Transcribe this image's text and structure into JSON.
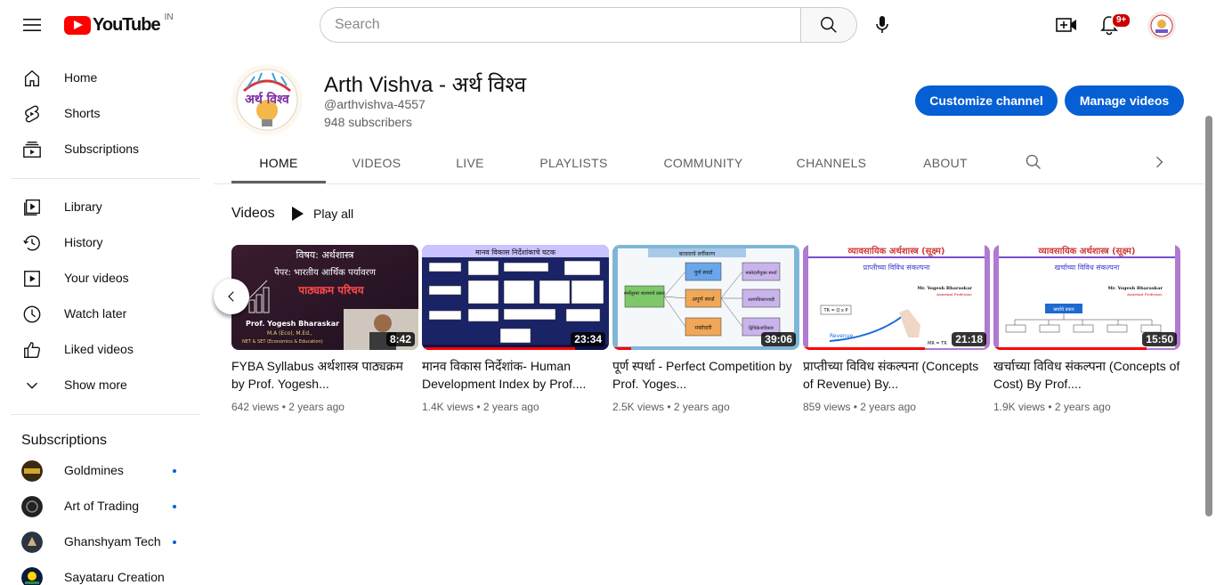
{
  "masthead": {
    "logo_text": "YouTube",
    "country_code": "IN",
    "search_placeholder": "Search",
    "notification_count": "9+"
  },
  "sidebar": {
    "primary": [
      {
        "label": "Home",
        "icon": "home-icon"
      },
      {
        "label": "Shorts",
        "icon": "shorts-icon"
      },
      {
        "label": "Subscriptions",
        "icon": "subscriptions-icon"
      }
    ],
    "library": [
      {
        "label": "Library",
        "icon": "library-icon"
      },
      {
        "label": "History",
        "icon": "history-icon"
      },
      {
        "label": "Your videos",
        "icon": "your-videos-icon"
      },
      {
        "label": "Watch later",
        "icon": "watch-later-icon"
      },
      {
        "label": "Liked videos",
        "icon": "liked-videos-icon"
      },
      {
        "label": "Show more",
        "icon": "chevron-down-icon"
      }
    ],
    "subscriptions_heading": "Subscriptions",
    "subscriptions": [
      {
        "label": "Goldmines",
        "new": true
      },
      {
        "label": "Art of Trading",
        "new": true
      },
      {
        "label": "Ghanshyam Tech",
        "new": true
      },
      {
        "label": "Sayataru Creation",
        "new": false
      }
    ]
  },
  "channel": {
    "name": "Arth Vishva - अर्थ विश्व",
    "handle": "@arthvishva-4557",
    "subscribers": "948 subscribers",
    "customize_label": "Customize channel",
    "manage_label": "Manage videos",
    "avatar_text": "अर्थ विश्व"
  },
  "tabs": [
    {
      "label": "HOME",
      "active": true
    },
    {
      "label": "VIDEOS",
      "active": false
    },
    {
      "label": "LIVE",
      "active": false
    },
    {
      "label": "PLAYLISTS",
      "active": false
    },
    {
      "label": "COMMUNITY",
      "active": false
    },
    {
      "label": "CHANNELS",
      "active": false
    },
    {
      "label": "ABOUT",
      "active": false
    }
  ],
  "section": {
    "title": "Videos",
    "play_all": "Play all"
  },
  "videos": [
    {
      "title": "FYBA Syllabus अर्थशास्त्र पाठ्यक्रम by Prof. Yogesh...",
      "duration": "8:42",
      "views": "642 views",
      "age": "2 years ago",
      "thumb_line1": "विषय: अर्थशास्त्र",
      "thumb_line2": "पेपर: भारतीय आर्थिक पर्यावरण",
      "thumb_line3": "पाठ्यक्रम परिचय",
      "thumb_line4": "Prof. Yogesh Bharaskar",
      "thumb_line5": "M.A (Eco), M.Ed.,",
      "thumb_line6": "NET & SET (Economics & Education)",
      "progress": 0
    },
    {
      "title": "मानव विकास निर्देशांक- Human Development Index by Prof....",
      "duration": "23:34",
      "views": "1.4K views",
      "age": "2 years ago",
      "thumb_line1": "मानव विकास निर्देशांकाचे घटक",
      "progress": 0.82
    },
    {
      "title": "पूर्ण स्पर्धा - Perfect Competition by Prof. Yoges...",
      "duration": "39:06",
      "views": "2.5K views",
      "age": "2 years ago",
      "thumb_line1": "बाजाराचे वर्गीकरण",
      "thumb_line2": "स्पर्धेनुसार बाजाराचे प्रकार",
      "thumb_line3": "पूर्ण स्पर्धा",
      "thumb_line4": "अपूर्ण स्पर्धा",
      "thumb_line5": "मक्तेदारी",
      "thumb_line6": "मक्तेदारीयुक्त स्पर्धा",
      "thumb_line7": "अल्पाधिकारशाही",
      "thumb_line8": "द्विविक्रेताधिकार",
      "progress": 0.1
    },
    {
      "title": "प्राप्तीच्या विविध संकल्पना (Concepts of Revenue) By...",
      "duration": "21:18",
      "views": "859 views",
      "age": "2 years ago",
      "thumb_line1": "व्यावसायिक अर्थशास्त्र (सूक्ष्म)",
      "thumb_line2": "प्राप्तीच्या विविध संकल्पना",
      "thumb_line3": "Mr. Yogesh Bharaskar",
      "thumb_line4": "Assistant Professor,",
      "thumb_line5": "TR = Q x P",
      "thumb_line6": "Revenue",
      "thumb_line7": "MR = TR",
      "progress": 0.65
    },
    {
      "title": "खर्चाच्या विविध संकल्पना (Concepts of Cost) By Prof....",
      "duration": "15:50",
      "views": "1.9K views",
      "age": "2 years ago",
      "thumb_line1": "व्यावसायिक अर्थशास्त्र (सूक्ष्म)",
      "thumb_line2": "खर्चाच्या विविध संकल्पना",
      "thumb_line3": "Mr. Yogesh Bharaskar",
      "thumb_line4": "Assistant Professor,",
      "thumb_line5": "खर्चाचे प्रकार",
      "progress": 0.82
    }
  ],
  "colors": {
    "brand_red": "#ff0000",
    "accent_blue": "#065fd4",
    "text_primary": "#0f0f0f",
    "text_secondary": "#606060"
  }
}
